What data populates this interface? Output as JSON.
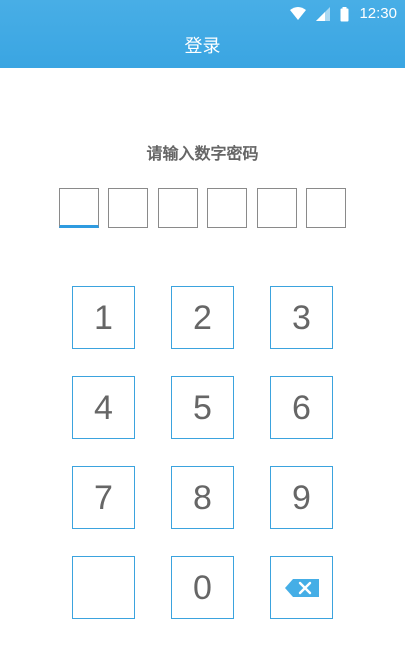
{
  "status_bar": {
    "time": "12:30",
    "icons": [
      "wifi-icon",
      "signal-icon",
      "battery-icon"
    ]
  },
  "header": {
    "title": "登录"
  },
  "prompt": {
    "text": "请输入数字密码"
  },
  "pin": {
    "length": 6,
    "entered": 0
  },
  "keypad": {
    "keys": [
      "1",
      "2",
      "3",
      "4",
      "5",
      "6",
      "7",
      "8",
      "9",
      "",
      "0"
    ],
    "delete_icon": "backspace-icon"
  },
  "colors": {
    "header": "#3aa5e2",
    "key_border": "#3ba3de",
    "text": "#666666",
    "pin_border": "#8a8a8a",
    "active_underline": "#2f9be0"
  }
}
